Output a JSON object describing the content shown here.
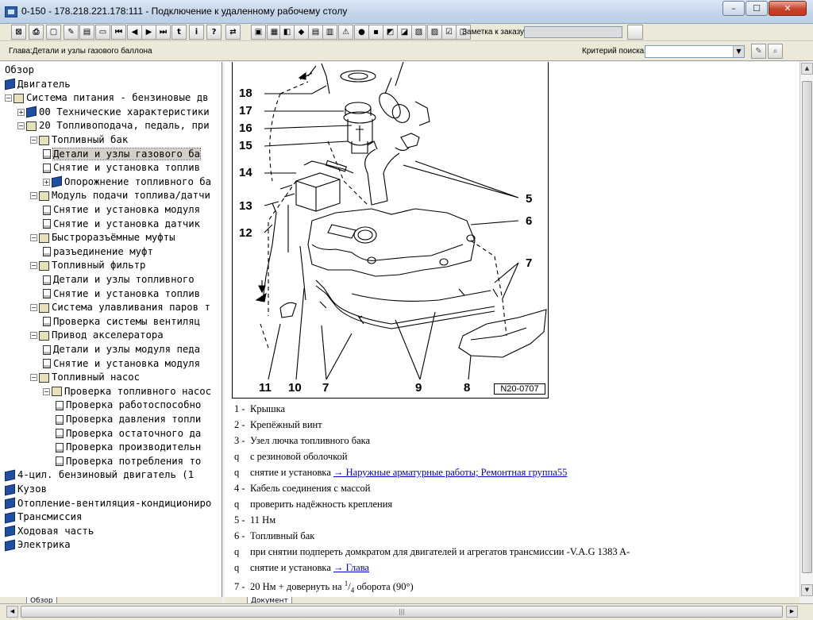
{
  "window": {
    "title": "0-150 - 178.218.221.178:111 - Подключение к удаленному рабочему столу",
    "minimize_glyph": "–",
    "maximize_glyph": "☐",
    "close_glyph": "✕"
  },
  "toolbar": {
    "buttons": [
      {
        "icon": "exit-icon",
        "glyph": "⊠"
      },
      {
        "icon": "print-icon",
        "glyph": "⎙"
      },
      {
        "icon": "new-page-icon",
        "glyph": "▢"
      },
      {
        "icon": "edit-page-icon",
        "glyph": "✎"
      },
      {
        "icon": "document-icon",
        "glyph": "▤"
      },
      {
        "icon": "car-icon",
        "glyph": "▭"
      },
      {
        "icon": "first-icon",
        "glyph": "⏮"
      },
      {
        "icon": "prev-icon",
        "glyph": "◀"
      },
      {
        "icon": "next-icon",
        "glyph": "▶"
      },
      {
        "icon": "last-icon",
        "glyph": "⏭"
      },
      {
        "icon": "level-up-icon",
        "glyph": "t"
      },
      {
        "icon": "info-icon",
        "glyph": "i"
      },
      {
        "icon": "help-icon",
        "glyph": "?"
      },
      {
        "icon": "swap-icon",
        "glyph": "⇄"
      },
      {
        "icon": "tool-1-icon",
        "glyph": "▣"
      },
      {
        "icon": "tool-2-icon",
        "glyph": "▦"
      },
      {
        "icon": "tool-3-icon",
        "glyph": "◧"
      },
      {
        "icon": "tool-4-icon",
        "glyph": "◆"
      },
      {
        "icon": "tool-5-icon",
        "glyph": "▤"
      },
      {
        "icon": "tool-6-icon",
        "glyph": "▥"
      },
      {
        "icon": "warning-icon",
        "glyph": "⚠"
      },
      {
        "icon": "tool-7-icon",
        "glyph": "●"
      },
      {
        "icon": "disk-icon",
        "glyph": "▪"
      },
      {
        "icon": "tool-8-icon",
        "glyph": "◩"
      },
      {
        "icon": "tool-9-icon",
        "glyph": "◪"
      },
      {
        "icon": "tool-10-icon",
        "glyph": "▧"
      },
      {
        "icon": "tool-11-icon",
        "glyph": "▨"
      },
      {
        "icon": "checklist-icon",
        "glyph": "☑"
      },
      {
        "icon": "tool-12-icon",
        "glyph": "◫"
      },
      {
        "icon": "notes-icon",
        "glyph": "▤"
      }
    ],
    "order_label": "Заметка к заказу:",
    "order_value": ""
  },
  "infobar": {
    "chapter": "Глава:Детали и узлы газового баллона",
    "criteria_label": "Критерий поиска:",
    "criteria_value": "",
    "search_glyph_1": "✎",
    "search_glyph_2": "⌕"
  },
  "tree": {
    "nodes": [
      {
        "indent": 0,
        "icon": "none",
        "expander": "",
        "label": "Обзор"
      },
      {
        "indent": 0,
        "icon": "book",
        "expander": "",
        "label": "Двигатель"
      },
      {
        "indent": 0,
        "icon": "openbook",
        "expander": "⊟",
        "label": "Система питания - бензиновые дв"
      },
      {
        "indent": 1,
        "icon": "book",
        "expander": "⊞",
        "label": "00 Технические характеристики"
      },
      {
        "indent": 1,
        "icon": "openbook",
        "expander": "⊟",
        "label": "20 Топливоподача, педаль, при"
      },
      {
        "indent": 2,
        "icon": "openbook",
        "expander": "⊟",
        "label": "Топливный бак"
      },
      {
        "indent": 3,
        "icon": "doc",
        "expander": "",
        "label": "Детали и узлы газового ба",
        "selected": true
      },
      {
        "indent": 3,
        "icon": "doc",
        "expander": "",
        "label": "Снятие и установка топлив"
      },
      {
        "indent": 3,
        "icon": "book",
        "expander": "⊞",
        "label": "Опорожнение топливного ба"
      },
      {
        "indent": 2,
        "icon": "openbook",
        "expander": "⊟",
        "label": "Модуль подачи топлива/датчи"
      },
      {
        "indent": 3,
        "icon": "doc",
        "expander": "",
        "label": "Снятие и установка модуля"
      },
      {
        "indent": 3,
        "icon": "doc",
        "expander": "",
        "label": "Снятие и установка датчик"
      },
      {
        "indent": 2,
        "icon": "openbook",
        "expander": "⊟",
        "label": "Быстроразъёмные муфты"
      },
      {
        "indent": 3,
        "icon": "doc",
        "expander": "",
        "label": "разъединение муфт"
      },
      {
        "indent": 2,
        "icon": "openbook",
        "expander": "⊟",
        "label": "Топливный фильтр"
      },
      {
        "indent": 3,
        "icon": "doc",
        "expander": "",
        "label": "Детали и узлы топливного"
      },
      {
        "indent": 3,
        "icon": "doc",
        "expander": "",
        "label": "Снятие и установка топлив"
      },
      {
        "indent": 2,
        "icon": "openbook",
        "expander": "⊟",
        "label": "Система улавливания паров т"
      },
      {
        "indent": 3,
        "icon": "doc",
        "expander": "",
        "label": "Проверка системы вентиляц"
      },
      {
        "indent": 2,
        "icon": "openbook",
        "expander": "⊟",
        "label": "Привод акселератора"
      },
      {
        "indent": 3,
        "icon": "doc",
        "expander": "",
        "label": "Детали и узлы модуля педа"
      },
      {
        "indent": 3,
        "icon": "doc",
        "expander": "",
        "label": "Снятие и установка модуля"
      },
      {
        "indent": 2,
        "icon": "openbook",
        "expander": "⊟",
        "label": "Топливный насос"
      },
      {
        "indent": 3,
        "icon": "openbook",
        "expander": "⊟",
        "label": "Проверка топливного насос"
      },
      {
        "indent": 4,
        "icon": "doc",
        "expander": "",
        "label": "Проверка работоспособно"
      },
      {
        "indent": 4,
        "icon": "doc",
        "expander": "",
        "label": "Проверка давления топли"
      },
      {
        "indent": 4,
        "icon": "doc",
        "expander": "",
        "label": "Проверка остаточного да"
      },
      {
        "indent": 4,
        "icon": "doc",
        "expander": "",
        "label": "Проверка производительн"
      },
      {
        "indent": 4,
        "icon": "doc",
        "expander": "",
        "label": "Проверка потребления то"
      },
      {
        "indent": 0,
        "icon": "book",
        "expander": "",
        "label": "4-цил. бензиновый двигатель (1"
      },
      {
        "indent": 0,
        "icon": "book",
        "expander": "",
        "label": "Кузов"
      },
      {
        "indent": 0,
        "icon": "book",
        "expander": "",
        "label": "Отопление-вентиляция-кондициониро"
      },
      {
        "indent": 0,
        "icon": "book",
        "expander": "",
        "label": "Трансмиссия"
      },
      {
        "indent": 0,
        "icon": "book",
        "expander": "",
        "label": "Ходовая часть"
      },
      {
        "indent": 0,
        "icon": "book",
        "expander": "",
        "label": "Электрика"
      }
    ],
    "tab_label": "Обзор"
  },
  "figure": {
    "code": "N20-0707",
    "left_numbers": [
      "18",
      "17",
      "16",
      "15",
      "14",
      "13",
      "12"
    ],
    "right_numbers": [
      "5",
      "6",
      "7"
    ],
    "bottom_numbers": [
      "11",
      "10",
      "7",
      "9",
      "8"
    ]
  },
  "legend": {
    "rows": [
      {
        "k": "1 -",
        "text": "Крышка"
      },
      {
        "k": "2 -",
        "text": "Крепёжный винт"
      },
      {
        "k": "3 -",
        "text": "Узел лючка топливного бака"
      },
      {
        "k": "q",
        "text": "с резиновой оболочкой"
      },
      {
        "k": "q",
        "text": "снятие и установка ",
        "link": "→ Наружные арматурные работы; Ремонтная группа55"
      },
      {
        "k": "4 -",
        "text": "Кабель соединения с массой"
      },
      {
        "k": "q",
        "text": "проверить надёжность крепления"
      },
      {
        "k": "5 -",
        "text": "11 Нм"
      },
      {
        "k": "6 -",
        "text": "Топливный бак"
      },
      {
        "k": "q",
        "text": "при снятии подпереть домкратом для двигателей и агрегатов трансмиссии -V.A.G 1383 A-"
      },
      {
        "k": "q",
        "text": "снятие и установка ",
        "link": "→ Глава"
      },
      {
        "k": "7 -",
        "text": "20 Нм + довернуть на ",
        "sup": "1",
        "sub": "4",
        "tail": " оборота (90°)"
      }
    ]
  },
  "right_tab_label": "Документ"
}
